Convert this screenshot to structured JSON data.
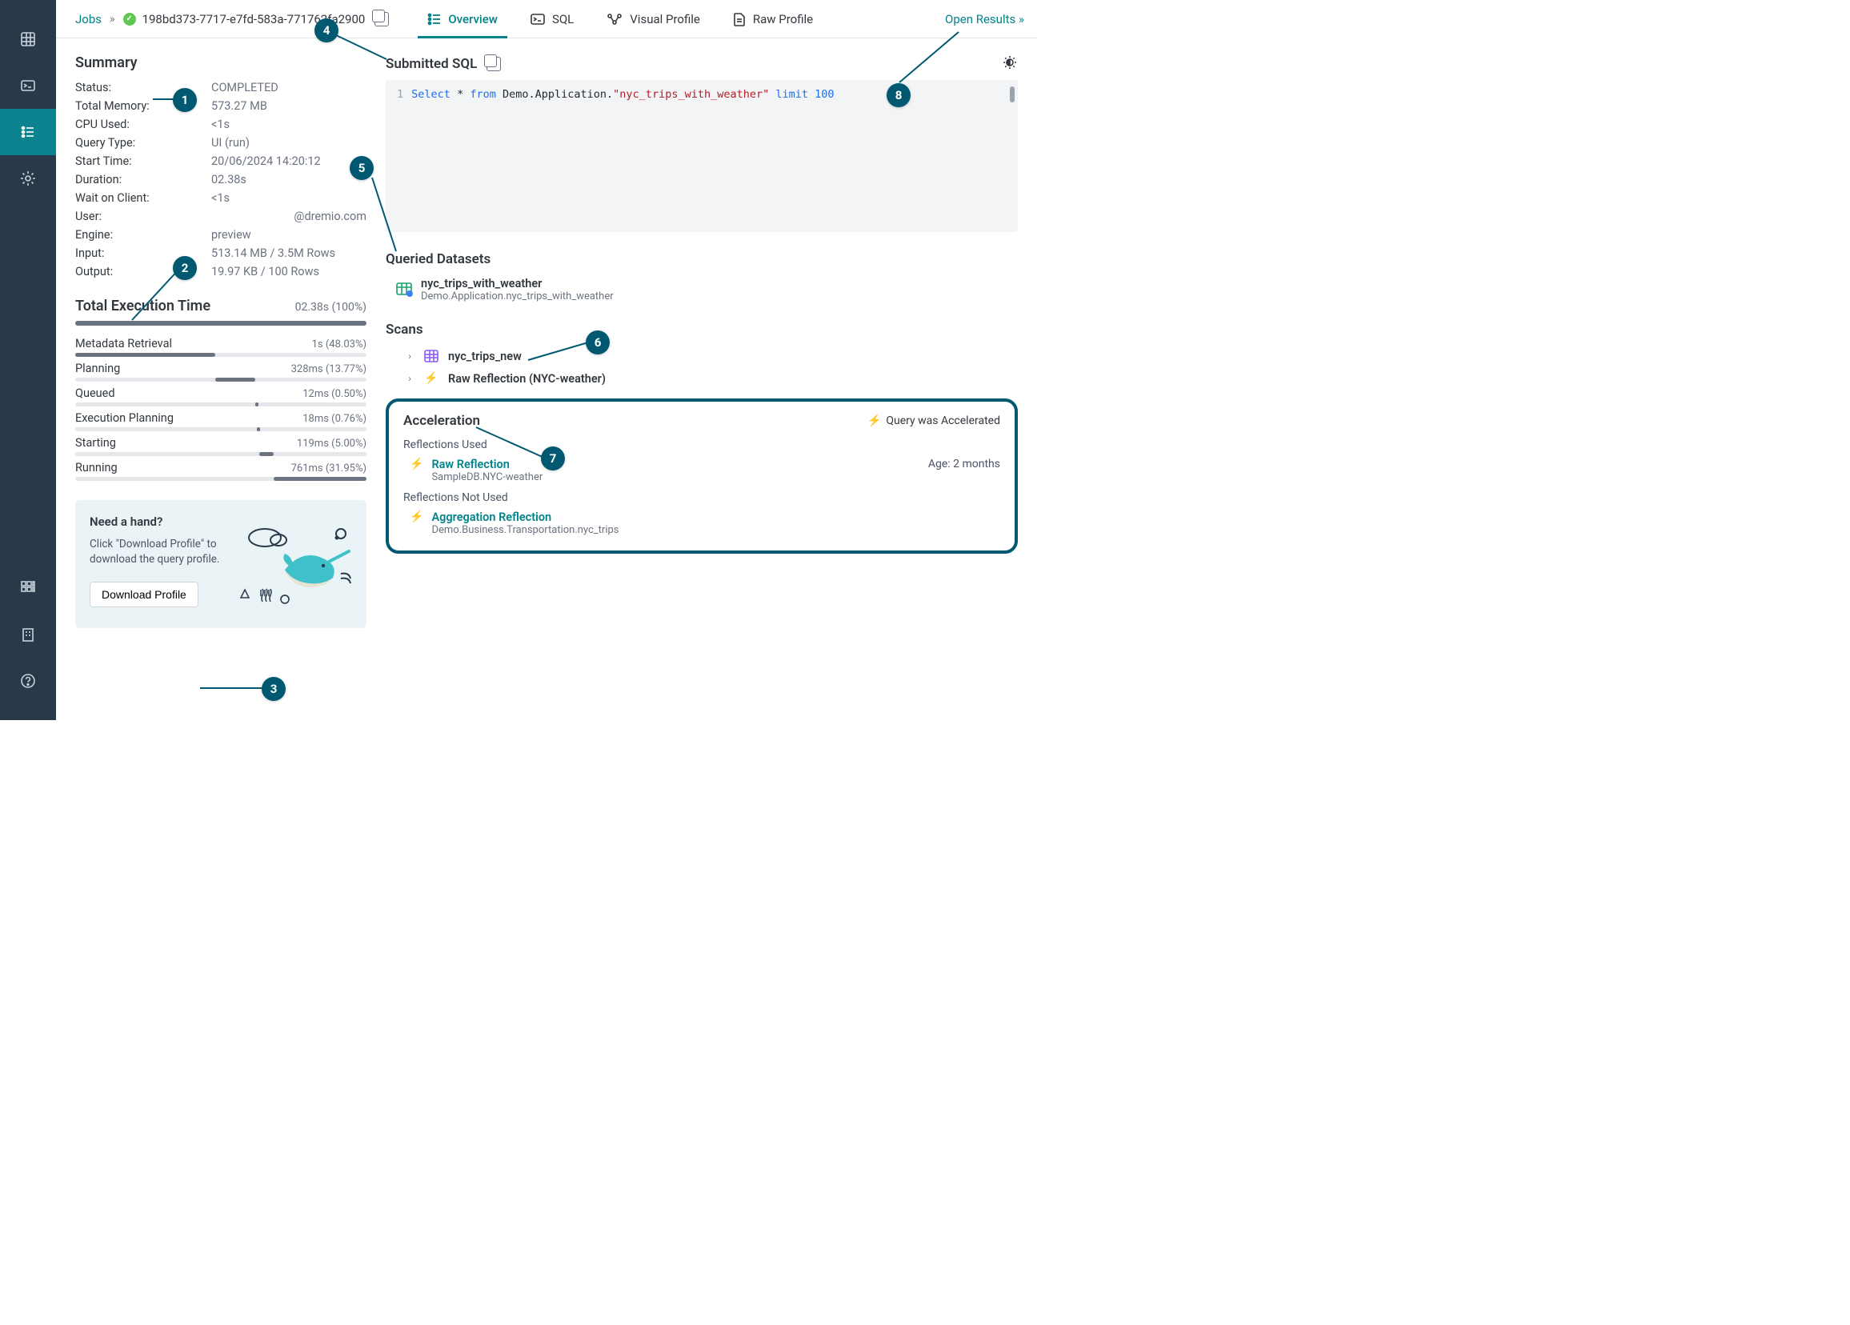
{
  "colors": {
    "accent": "#008489",
    "sidebar_bg": "#2a394a",
    "callout": "#005971"
  },
  "header": {
    "breadcrumb_root": "Jobs",
    "job_id": "198bd373-7717-e7fd-583a-771762fa2900",
    "open_results_label": "Open Results »",
    "tabs": [
      {
        "label": "Overview",
        "icon": "list-icon",
        "active": true
      },
      {
        "label": "SQL",
        "icon": "terminal-icon",
        "active": false
      },
      {
        "label": "Visual Profile",
        "icon": "visual-profile-icon",
        "active": false
      },
      {
        "label": "Raw Profile",
        "icon": "document-icon",
        "active": false
      }
    ]
  },
  "summary": {
    "title": "Summary",
    "rows": [
      {
        "k": "Status:",
        "v": "COMPLETED"
      },
      {
        "k": "Total Memory:",
        "v": "573.27 MB"
      },
      {
        "k": "CPU Used:",
        "v": "<1s"
      },
      {
        "k": "Query Type:",
        "v": "UI (run)"
      },
      {
        "k": "Start Time:",
        "v": "20/06/2024 14:20:12"
      },
      {
        "k": "Duration:",
        "v": "02.38s"
      },
      {
        "k": "Wait on Client:",
        "v": "<1s"
      },
      {
        "k": "User:",
        "v": "@dremio.com",
        "align": "right"
      },
      {
        "k": "Engine:",
        "v": "preview"
      },
      {
        "k": "Input:",
        "v": "513.14 MB / 3.5M Rows"
      },
      {
        "k": "Output:",
        "v": "19.97 KB / 100 Rows"
      }
    ]
  },
  "exec": {
    "title": "Total Execution Time",
    "total_label": "02.38s (100%)",
    "phases": [
      {
        "label": "Metadata Retrieval",
        "value": "1s (48.03%)",
        "offset": 0,
        "width": 48.03
      },
      {
        "label": "Planning",
        "value": "328ms (13.77%)",
        "offset": 48.03,
        "width": 13.77
      },
      {
        "label": "Queued",
        "value": "12ms (0.50%)",
        "offset": 61.8,
        "width": 0.5
      },
      {
        "label": "Execution Planning",
        "value": "18ms (0.76%)",
        "offset": 62.3,
        "width": 0.76
      },
      {
        "label": "Starting",
        "value": "119ms (5.00%)",
        "offset": 63.06,
        "width": 5.0
      },
      {
        "label": "Running",
        "value": "761ms (31.95%)",
        "offset": 68.06,
        "width": 31.95
      }
    ]
  },
  "help": {
    "title": "Need a hand?",
    "body": "Click \"Download Profile\" to download the query profile.",
    "button": "Download Profile"
  },
  "sql": {
    "title": "Submitted SQL",
    "line_number": "1",
    "tokens": {
      "select": "Select",
      "star": "*",
      "from": "from",
      "path": "Demo.Application.",
      "quoted": "\"nyc_trips_with_weather\"",
      "limit": "limit",
      "num": "100"
    }
  },
  "queried": {
    "title": "Queried Datasets",
    "item_name": "nyc_trips_with_weather",
    "item_path": "Demo.Application.nyc_trips_with_weather"
  },
  "scans": {
    "title": "Scans",
    "items": [
      {
        "name": "nyc_trips_new",
        "icon": "table-icon"
      },
      {
        "name": "Raw Reflection (NYC-weather)",
        "icon": "bolt-icon"
      }
    ]
  },
  "accel": {
    "title": "Acceleration",
    "badge": "Query was Accelerated",
    "used_label": "Reflections Used",
    "used": {
      "name": "Raw Reflection",
      "path": "SampleDB.NYC-weather",
      "age": "Age: 2 months"
    },
    "notused_label": "Reflections Not Used",
    "notused": {
      "name": "Aggregation Reflection",
      "path": "Demo.Business.Transportation.nyc_trips"
    }
  },
  "callouts": [
    "1",
    "2",
    "3",
    "4",
    "5",
    "6",
    "7",
    "8"
  ]
}
